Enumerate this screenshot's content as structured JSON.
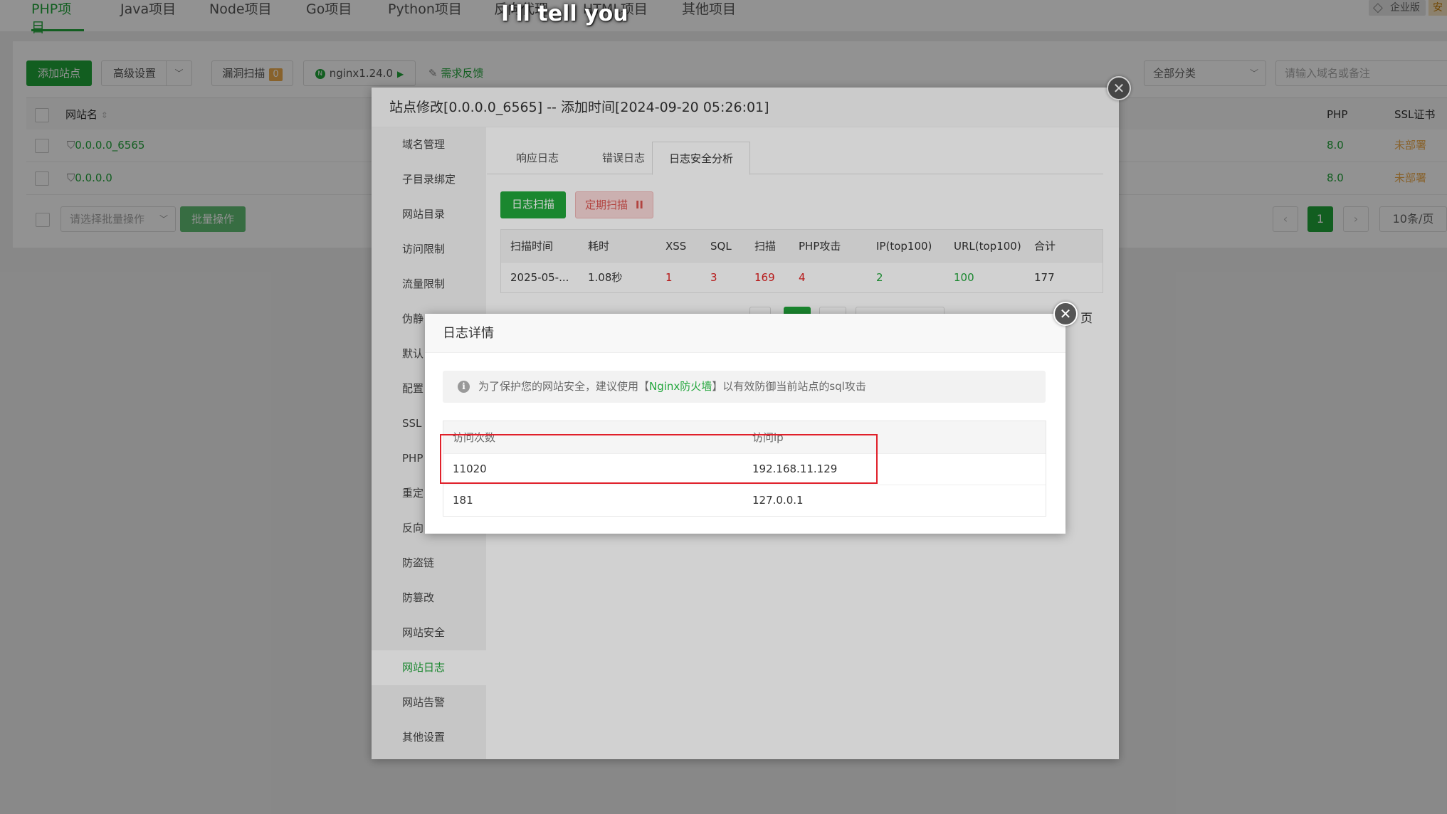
{
  "caption": "I'll tell you",
  "top_tabs": [
    "PHP项目",
    "Java项目",
    "Node项目",
    "Go项目",
    "Python项目",
    "反向代理",
    "HTML项目",
    "其他项目"
  ],
  "enterprise_badge": "企业版",
  "edge_badge": "安",
  "toolbar": {
    "add_site": "添加站点",
    "advanced": "高级设置",
    "vuln_scan": "漏洞扫描",
    "vuln_count": "0",
    "nginx": "nginx1.24.0",
    "feedback": "需求反馈",
    "category": "全部分类",
    "search_placeholder": "请输入域名或备注"
  },
  "site_table": {
    "headers": {
      "name": "网站名",
      "php": "PHP",
      "ssl": "SSL证书"
    },
    "rows": [
      {
        "name": "0.0.0.0_6565",
        "php": "8.0",
        "ssl": "未部署"
      },
      {
        "name": "0.0.0.0",
        "php": "8.0",
        "ssl": "未部署"
      }
    ],
    "batch_placeholder": "请选择批量操作",
    "batch_button": "批量操作",
    "page": "1",
    "page_size": "10条/页",
    "prev": "‹",
    "next": "›"
  },
  "site_dialog": {
    "title": "站点修改[0.0.0.0_6565] -- 添加时间[2024-09-20 05:26:01]",
    "sidebar": [
      "域名管理",
      "子目录绑定",
      "网站目录",
      "访问限制",
      "流量限制",
      "伪静",
      "默认",
      "配置",
      "SSL",
      "PHP",
      "重定",
      "反向",
      "防盗链",
      "防篡改",
      "网站安全",
      "网站日志",
      "网站告警",
      "其他设置"
    ],
    "active_sidebar": "网站日志",
    "subtabs": [
      "响应日志",
      "错误日志",
      "日志安全分析"
    ],
    "scan_button": "日志扫描",
    "schedule_button": "定期扫描",
    "schedule_icon": "II",
    "scan_table": {
      "headers": [
        "扫描时间",
        "耗时",
        "XSS",
        "SQL",
        "扫描",
        "PHP攻击",
        "IP(top100)",
        "URL(top100)",
        "合计"
      ],
      "row": [
        "2025-05-...",
        "1.08秒",
        "1",
        "3",
        "169",
        "4",
        "2",
        "100",
        "177"
      ]
    },
    "page_suffix": "页"
  },
  "log_dialog": {
    "title": "日志详情",
    "notice_before": "为了保护您的网站安全，建议使用【",
    "notice_link": "Nginx防火墙",
    "notice_after": "】以有效防御当前站点的sql攻击",
    "headers": {
      "count": "访问次数",
      "ip": "访问ip"
    },
    "rows": [
      {
        "count": "11020",
        "ip": "192.168.11.129"
      },
      {
        "count": "181",
        "ip": "127.0.0.1"
      }
    ]
  },
  "colors": {
    "accent": "#20a53a",
    "danger": "#e0202a",
    "warning": "#f0ad4e"
  }
}
